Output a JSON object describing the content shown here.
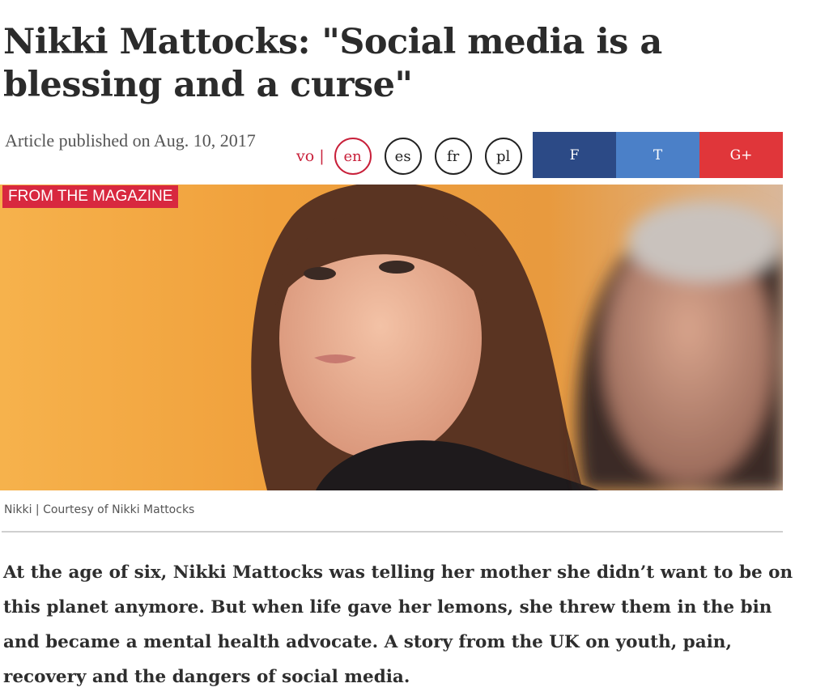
{
  "article": {
    "title": "Nikki Mattocks: \"Social media is a blessing and a curse\"",
    "published": "Article published on Aug. 10, 2017",
    "tag": "FROM THE MAGAZINE",
    "caption": "Nikki | Courtesy of Nikki Mattocks",
    "lead": "At the age of six, Nikki Mattocks was telling her mother she didn’t want to be on this planet anymore. But when life gave her lemons, she threw them in the bin and became a mental health advocate. A story from the UK on youth, pain, recovery and the dangers of social media."
  },
  "languages": {
    "vo_label": "vo |",
    "items": [
      "en",
      "es",
      "fr",
      "pl"
    ],
    "active": "en"
  },
  "share": {
    "facebook": "F",
    "twitter": "T",
    "googleplus": "G+"
  },
  "colors": {
    "accent": "#c8203a",
    "tag_bg": "#d8283f",
    "facebook": "#2c4a86",
    "twitter": "#4b80c8",
    "googleplus": "#e0363a"
  }
}
